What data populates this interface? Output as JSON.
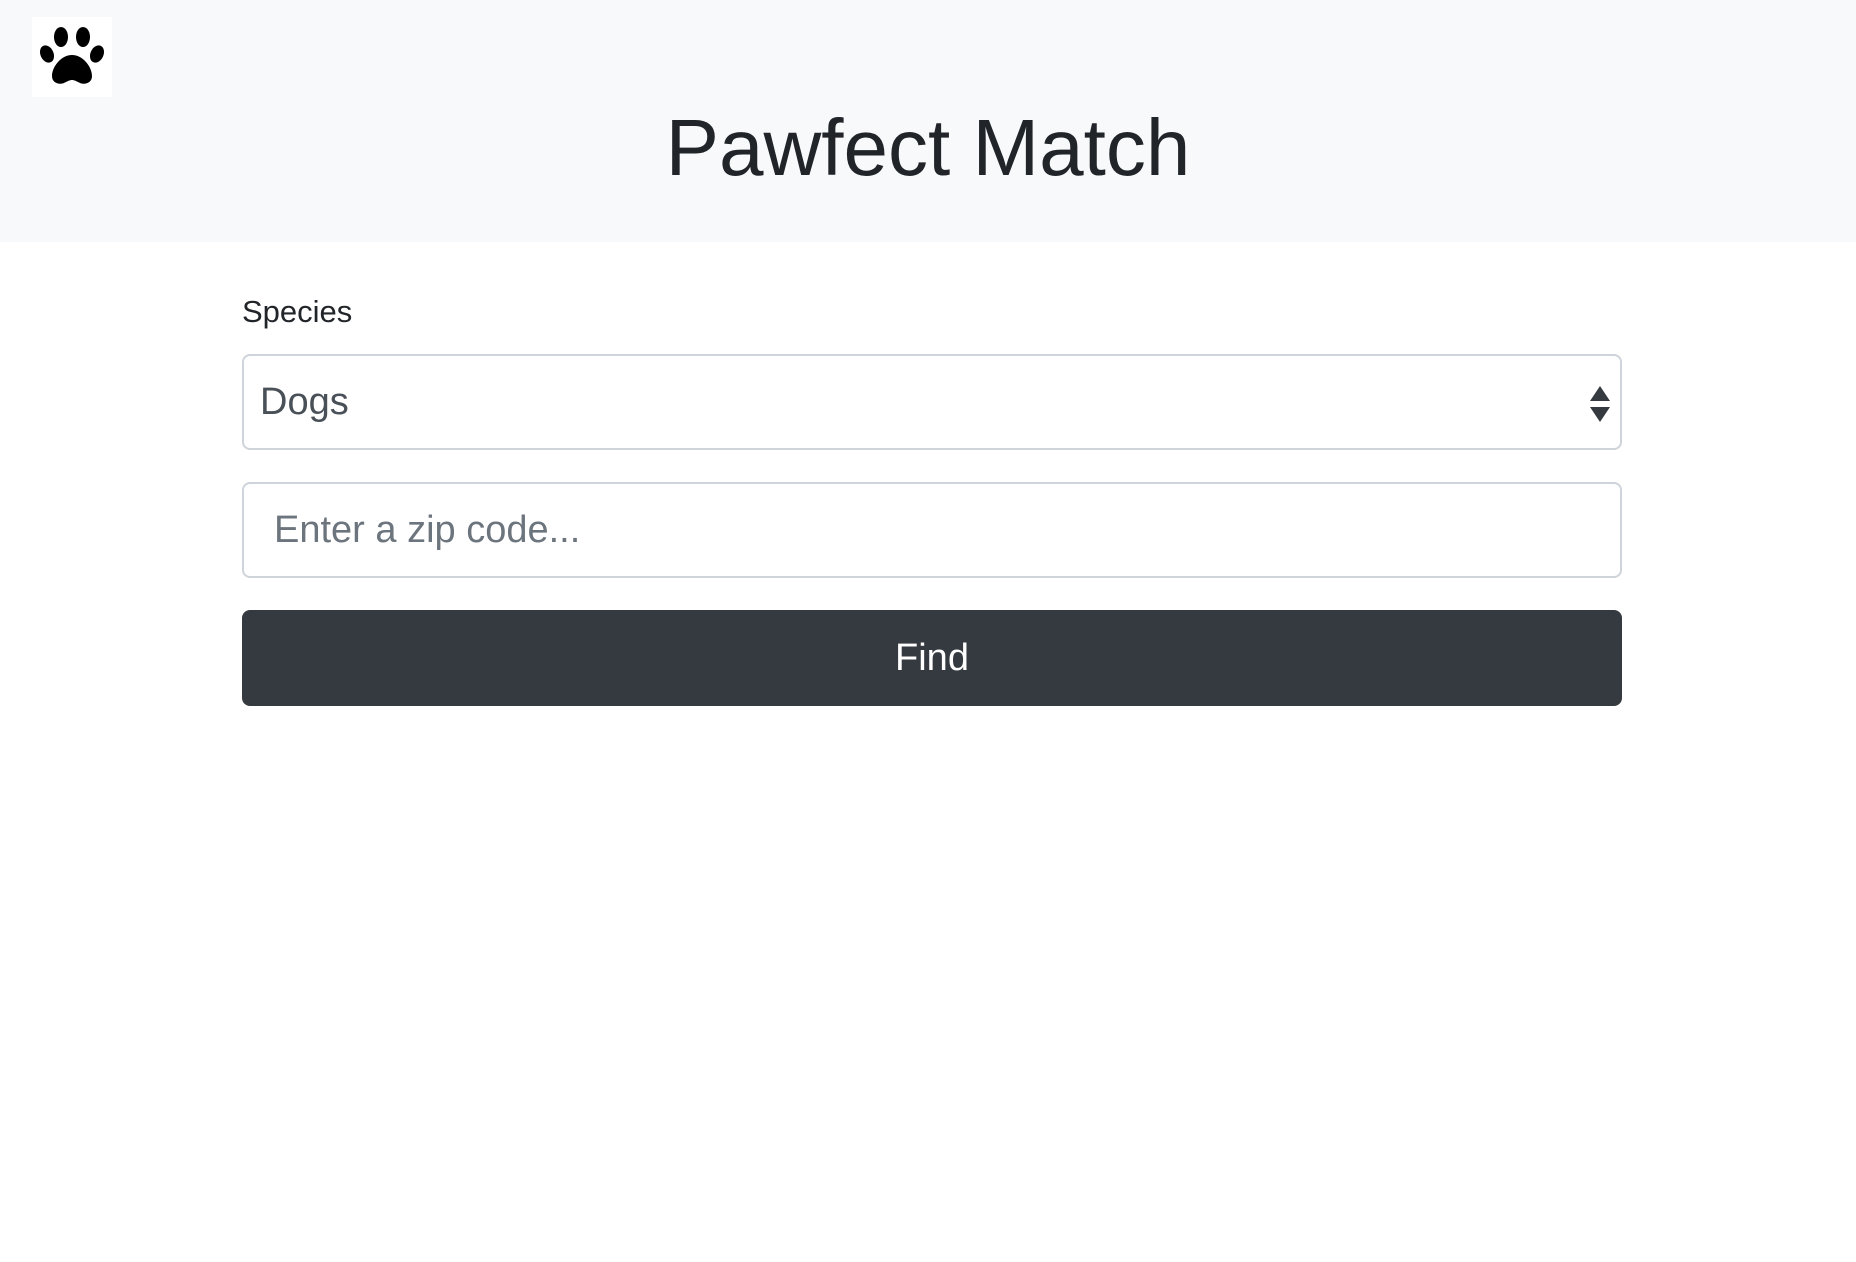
{
  "header": {
    "logo_icon": "paw-print-icon",
    "title": "Pawfect Match"
  },
  "form": {
    "species_label": "Species",
    "species_selected": "Dogs",
    "zip_placeholder": "Enter a zip code...",
    "zip_value": "",
    "find_label": "Find"
  },
  "colors": {
    "header_bg": "#f8f9fa",
    "button_bg": "#343a40",
    "button_text": "#ffffff",
    "input_border": "#ced4da"
  }
}
